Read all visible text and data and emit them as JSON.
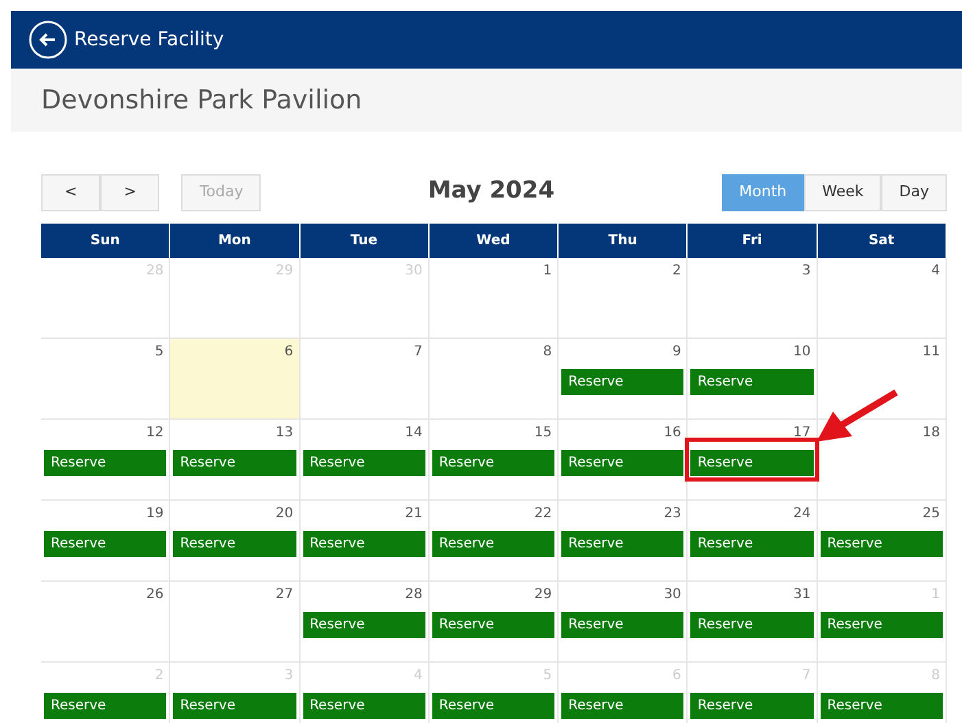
{
  "app_bar": {
    "back_icon": true,
    "title": "Reserve Facility"
  },
  "facility": "Devonshire Park Pavilion",
  "toolbar": {
    "prev": "<",
    "next": ">",
    "today": {
      "label": "Today",
      "disabled": true
    },
    "title": "May 2024",
    "views": [
      {
        "label": "Month",
        "selected": true
      },
      {
        "label": "Week",
        "selected": false
      },
      {
        "label": "Day",
        "selected": false
      }
    ]
  },
  "weekdays": [
    "Sun",
    "Mon",
    "Tue",
    "Wed",
    "Thu",
    "Fri",
    "Sat"
  ],
  "weeks": [
    [
      {
        "day": "28",
        "other_month": true,
        "today": false
      },
      {
        "day": "29",
        "other_month": true,
        "today": false
      },
      {
        "day": "30",
        "other_month": true,
        "today": false
      },
      {
        "day": "1",
        "other_month": false,
        "today": false
      },
      {
        "day": "2",
        "other_month": false,
        "today": false
      },
      {
        "day": "3",
        "other_month": false,
        "today": false
      },
      {
        "day": "4",
        "other_month": false,
        "today": false
      }
    ],
    [
      {
        "day": "5",
        "other_month": false,
        "today": false
      },
      {
        "day": "6",
        "other_month": false,
        "today": true
      },
      {
        "day": "7",
        "other_month": false,
        "today": false
      },
      {
        "day": "8",
        "other_month": false,
        "today": false
      },
      {
        "day": "9",
        "other_month": false,
        "today": false,
        "event": {
          "label": "Reserve",
          "highlighted": false
        }
      },
      {
        "day": "10",
        "other_month": false,
        "today": false,
        "event": {
          "label": "Reserve",
          "highlighted": false
        }
      },
      {
        "day": "11",
        "other_month": false,
        "today": false
      }
    ],
    [
      {
        "day": "12",
        "other_month": false,
        "today": false,
        "event": {
          "label": "Reserve",
          "highlighted": false
        }
      },
      {
        "day": "13",
        "other_month": false,
        "today": false,
        "event": {
          "label": "Reserve",
          "highlighted": false
        }
      },
      {
        "day": "14",
        "other_month": false,
        "today": false,
        "event": {
          "label": "Reserve",
          "highlighted": false
        }
      },
      {
        "day": "15",
        "other_month": false,
        "today": false,
        "event": {
          "label": "Reserve",
          "highlighted": false
        }
      },
      {
        "day": "16",
        "other_month": false,
        "today": false,
        "event": {
          "label": "Reserve",
          "highlighted": false
        }
      },
      {
        "day": "17",
        "other_month": false,
        "today": false,
        "event": {
          "label": "Reserve",
          "highlighted": true
        }
      },
      {
        "day": "18",
        "other_month": false,
        "today": false
      }
    ],
    [
      {
        "day": "19",
        "other_month": false,
        "today": false,
        "event": {
          "label": "Reserve",
          "highlighted": false
        }
      },
      {
        "day": "20",
        "other_month": false,
        "today": false,
        "event": {
          "label": "Reserve",
          "highlighted": false
        }
      },
      {
        "day": "21",
        "other_month": false,
        "today": false,
        "event": {
          "label": "Reserve",
          "highlighted": false
        }
      },
      {
        "day": "22",
        "other_month": false,
        "today": false,
        "event": {
          "label": "Reserve",
          "highlighted": false
        }
      },
      {
        "day": "23",
        "other_month": false,
        "today": false,
        "event": {
          "label": "Reserve",
          "highlighted": false
        }
      },
      {
        "day": "24",
        "other_month": false,
        "today": false,
        "event": {
          "label": "Reserve",
          "highlighted": false
        }
      },
      {
        "day": "25",
        "other_month": false,
        "today": false,
        "event": {
          "label": "Reserve",
          "highlighted": false
        }
      }
    ],
    [
      {
        "day": "26",
        "other_month": false,
        "today": false
      },
      {
        "day": "27",
        "other_month": false,
        "today": false
      },
      {
        "day": "28",
        "other_month": false,
        "today": false,
        "event": {
          "label": "Reserve",
          "highlighted": false
        }
      },
      {
        "day": "29",
        "other_month": false,
        "today": false,
        "event": {
          "label": "Reserve",
          "highlighted": false
        }
      },
      {
        "day": "30",
        "other_month": false,
        "today": false,
        "event": {
          "label": "Reserve",
          "highlighted": false
        }
      },
      {
        "day": "31",
        "other_month": false,
        "today": false,
        "event": {
          "label": "Reserve",
          "highlighted": false
        }
      },
      {
        "day": "1",
        "other_month": true,
        "today": false,
        "event": {
          "label": "Reserve",
          "highlighted": false
        }
      }
    ],
    [
      {
        "day": "2",
        "other_month": true,
        "today": false,
        "event": {
          "label": "Reserve",
          "highlighted": false
        }
      },
      {
        "day": "3",
        "other_month": true,
        "today": false,
        "event": {
          "label": "Reserve",
          "highlighted": false
        }
      },
      {
        "day": "4",
        "other_month": true,
        "today": false,
        "event": {
          "label": "Reserve",
          "highlighted": false
        }
      },
      {
        "day": "5",
        "other_month": true,
        "today": false,
        "event": {
          "label": "Reserve",
          "highlighted": false
        }
      },
      {
        "day": "6",
        "other_month": true,
        "today": false,
        "event": {
          "label": "Reserve",
          "highlighted": false
        }
      },
      {
        "day": "7",
        "other_month": true,
        "today": false,
        "event": {
          "label": "Reserve",
          "highlighted": false
        }
      },
      {
        "day": "8",
        "other_month": true,
        "today": false,
        "event": {
          "label": "Reserve",
          "highlighted": false
        }
      }
    ]
  ]
}
